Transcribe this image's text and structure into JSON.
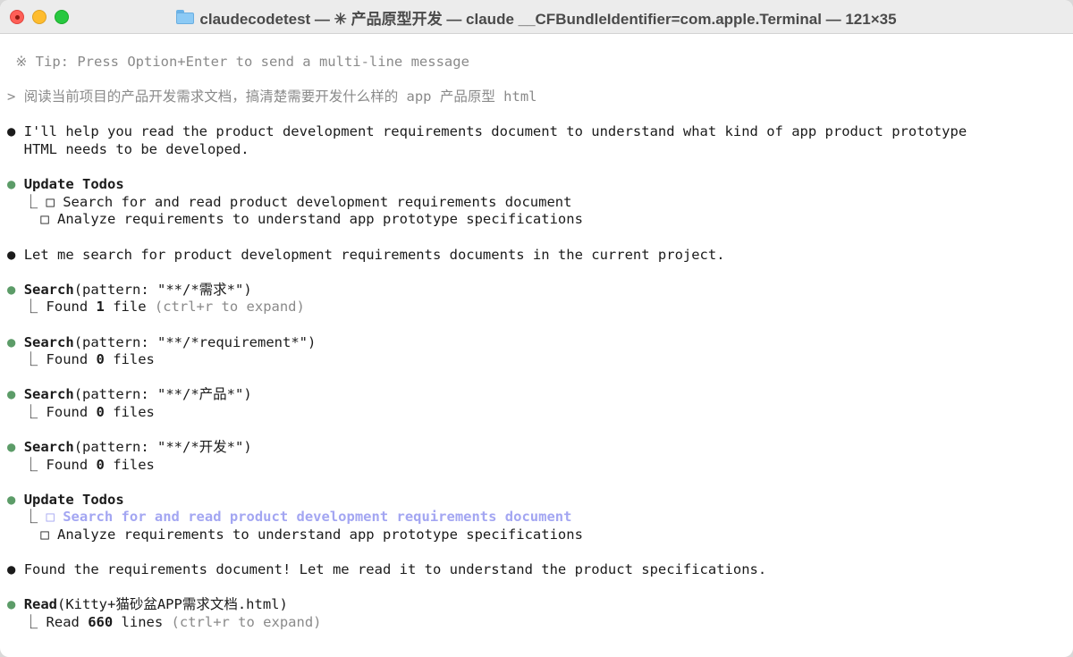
{
  "window": {
    "title": "claudecodetest — ✳ 产品原型开发 — claude __CFBundleIdentifier=com.apple.Terminal — 121×35"
  },
  "terminal": {
    "tip": "※ Tip: Press Option+Enter to send a multi-line message",
    "prompt_symbol": ">",
    "user_input": "阅读当前项目的产品开发需求文档，搞清楚需要开发什么样的 app 产品原型 html",
    "bullet": "●",
    "tree": "⎿",
    "box": "□",
    "msg1_line1": "I'll help you read the product development requirements document to understand what kind of app product prototype",
    "msg1_line2": "HTML needs to be developed.",
    "todos1": {
      "title": "Update Todos",
      "item1": "Search for and read product development requirements document",
      "item2": "Analyze requirements to understand app prototype specifications"
    },
    "msg2": "Let me search for product development requirements documents in the current project.",
    "search1": {
      "tool": "Search",
      "args": "(pattern: \"**/*需求*\")",
      "found": "Found ",
      "count": "1",
      "unit": " file ",
      "hint": "(ctrl+r to expand)"
    },
    "search2": {
      "tool": "Search",
      "args": "(pattern: \"**/*requirement*\")",
      "found": "Found ",
      "count": "0",
      "unit": " files"
    },
    "search3": {
      "tool": "Search",
      "args": "(pattern: \"**/*产品*\")",
      "found": "Found ",
      "count": "0",
      "unit": " files"
    },
    "search4": {
      "tool": "Search",
      "args": "(pattern: \"**/*开发*\")",
      "found": "Found ",
      "count": "0",
      "unit": " files"
    },
    "todos2": {
      "title": "Update Todos",
      "item1": "Search for and read product development requirements document",
      "item2": "Analyze requirements to understand app prototype specifications"
    },
    "msg3": "Found the requirements document! Let me read it to understand the product specifications.",
    "read": {
      "tool": "Read",
      "args": "(Kitty+猫砂盆APP需求文档.html)",
      "prefix": "Read ",
      "count": "660",
      "unit": " lines ",
      "hint": "(ctrl+r to expand)"
    }
  },
  "colors": {
    "bullet_green": "#5c9c68",
    "active_todo": "#a3a6f2",
    "dim_text": "#8a8a8a"
  }
}
